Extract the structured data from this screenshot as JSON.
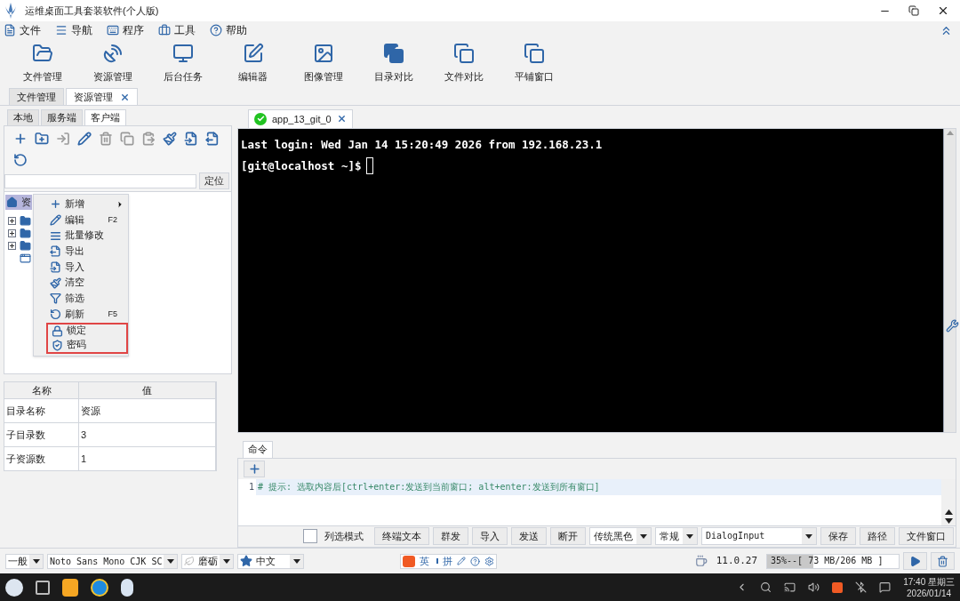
{
  "window": {
    "title": "运维桌面工具套装软件(个人版)"
  },
  "menu_bar": [
    {
      "kind": "file",
      "label": "文件"
    },
    {
      "kind": "nav",
      "label": "导航"
    },
    {
      "kind": "program",
      "label": "程序"
    },
    {
      "kind": "tools",
      "label": "工具"
    },
    {
      "kind": "help",
      "label": "帮助"
    }
  ],
  "toolbar": [
    {
      "kind": "folder",
      "label": "文件管理"
    },
    {
      "kind": "dish",
      "label": "资源管理"
    },
    {
      "kind": "monitor",
      "label": "后台任务"
    },
    {
      "kind": "edit",
      "label": "编辑器"
    },
    {
      "kind": "image",
      "label": "图像管理"
    },
    {
      "kind": "dircompare",
      "label": "目录对比"
    },
    {
      "kind": "filecompare",
      "label": "文件对比"
    },
    {
      "kind": "tile",
      "label": "平铺窗口"
    }
  ],
  "doc_tabs": [
    {
      "label": "文件管理",
      "selected": false,
      "closable": false
    },
    {
      "label": "资源管理",
      "selected": true,
      "closable": true
    }
  ],
  "left_panel": {
    "tabs": [
      {
        "label": "本地",
        "selected": false
      },
      {
        "label": "服务端",
        "selected": false
      },
      {
        "label": "客户端",
        "selected": true
      }
    ],
    "tools": [
      {
        "kind": "add",
        "disabled": false
      },
      {
        "kind": "newfolder",
        "disabled": false
      },
      {
        "kind": "login",
        "disabled": true
      },
      {
        "kind": "edit",
        "disabled": false
      },
      {
        "kind": "delete",
        "disabled": true
      },
      {
        "kind": "copy",
        "disabled": true
      },
      {
        "kind": "paste",
        "disabled": true
      },
      {
        "kind": "clear",
        "disabled": false
      },
      {
        "kind": "import",
        "disabled": false
      },
      {
        "kind": "export",
        "disabled": false
      },
      {
        "kind": "refresh",
        "disabled": false
      }
    ],
    "locate_button": "定位",
    "tree": {
      "label": "资",
      "selected": true,
      "children": [
        {
          "kind": "folder",
          "expanded": false
        },
        {
          "kind": "folder",
          "expanded": false
        },
        {
          "kind": "folder",
          "expanded": false
        },
        {
          "kind": "window"
        }
      ]
    },
    "context_menu": [
      {
        "kind": "add",
        "label": "新增",
        "submenu": true,
        "highlighted": false
      },
      {
        "kind": "edit",
        "label": "编辑",
        "shortcut": "F2",
        "submenu": false,
        "highlighted": false
      },
      {
        "kind": "batch",
        "label": "批量修改",
        "submenu": false,
        "highlighted": false
      },
      {
        "kind": "export",
        "label": "导出",
        "submenu": false,
        "highlighted": false
      },
      {
        "kind": "import",
        "label": "导入",
        "submenu": false,
        "highlighted": false
      },
      {
        "kind": "clear",
        "label": "清空",
        "submenu": false,
        "highlighted": false
      },
      {
        "kind": "filter",
        "label": "筛选",
        "submenu": false,
        "highlighted": false
      },
      {
        "kind": "refresh",
        "label": "刷新",
        "shortcut": "F5",
        "submenu": false,
        "highlighted": false
      },
      {
        "kind": "lock",
        "label": "锁定",
        "submenu": false,
        "highlighted": true
      },
      {
        "kind": "password",
        "label": "密码",
        "submenu": false,
        "highlighted": true
      }
    ],
    "properties": {
      "columns": [
        "名称",
        "值"
      ],
      "rows": [
        [
          "目录名称",
          "资源"
        ],
        [
          "子目录数",
          "3"
        ],
        [
          "子资源数",
          "1"
        ]
      ]
    }
  },
  "terminal": {
    "tab": {
      "label": "app_13_git_0",
      "connected": true
    },
    "lines": [
      "Last login: Wed Jan 14 15:20:49 2026 from 192.168.23.1",
      "[git@localhost ~]$"
    ]
  },
  "command_panel": {
    "tab": "命令",
    "line_number": "1",
    "text": "# 提示: 选取内容后[ctrl+enter:发送到当前窗口; alt+enter:发送到所有窗口]",
    "controls": [
      {
        "kind": "checkbox",
        "label": "列选模式",
        "checked": false
      },
      {
        "kind": "button",
        "label": "终端文本"
      },
      {
        "kind": "button",
        "label": "群发"
      },
      {
        "kind": "button",
        "label": "导入"
      },
      {
        "kind": "button",
        "label": "发送"
      },
      {
        "kind": "button",
        "label": "断开"
      },
      {
        "kind": "select",
        "label": "传统黑色"
      },
      {
        "kind": "select",
        "label": "常规"
      },
      {
        "kind": "wideselect",
        "label": "DialogInput"
      },
      {
        "kind": "button",
        "label": "保存"
      },
      {
        "kind": "button",
        "label": "路径"
      },
      {
        "kind": "button",
        "label": "文件窗口"
      }
    ]
  },
  "status_bar": {
    "selects": [
      {
        "kind": "plain",
        "label": "一般"
      },
      {
        "kind": "plain",
        "label": "Noto Sans Mono CJK SC"
      },
      {
        "kind": "leaf",
        "label": "磨砺"
      },
      {
        "kind": "star",
        "label": "中文"
      }
    ],
    "ime": [
      "英",
      "拼"
    ],
    "java_version": "11.0.27",
    "memory": {
      "text": "35%--[ 73 MB/206 MB ]",
      "level": 0.35
    }
  },
  "taskbar": {
    "time": "17:40 星期三",
    "date": "2026/01/14"
  }
}
